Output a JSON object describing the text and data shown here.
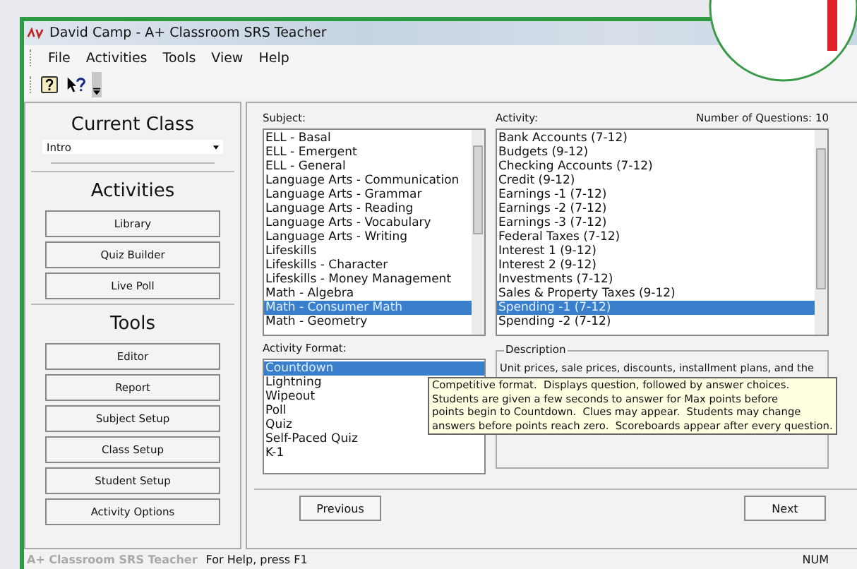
{
  "window": {
    "title": "David Camp - A+ Classroom SRS Teacher"
  },
  "menu": [
    "File",
    "Activities",
    "Tools",
    "View",
    "Help"
  ],
  "sidebar": {
    "current_class_heading": "Current Class",
    "class_dropdown": {
      "value": "Intro"
    },
    "sections": [
      {
        "heading": "Activities",
        "buttons": [
          "Library",
          "Quiz Builder",
          "Live Poll"
        ]
      },
      {
        "heading": "Tools",
        "buttons": [
          "Editor",
          "Report",
          "Subject Setup",
          "Class Setup",
          "Student Setup",
          "Activity Options"
        ]
      }
    ]
  },
  "subject": {
    "label": "Subject:",
    "items": [
      {
        "text": "ELL - Basal",
        "selected": false
      },
      {
        "text": "ELL - Emergent",
        "selected": false
      },
      {
        "text": "ELL - General",
        "selected": false
      },
      {
        "text": "Language Arts - Communication",
        "selected": false
      },
      {
        "text": "Language Arts - Grammar",
        "selected": false
      },
      {
        "text": "Language Arts - Reading",
        "selected": false
      },
      {
        "text": "Language Arts - Vocabulary",
        "selected": false
      },
      {
        "text": "Language Arts - Writing",
        "selected": false
      },
      {
        "text": "Lifeskills",
        "selected": false
      },
      {
        "text": "Lifeskills - Character",
        "selected": false
      },
      {
        "text": "Lifeskills - Money Management",
        "selected": false
      },
      {
        "text": "Math - Algebra",
        "selected": false
      },
      {
        "text": "Math - Consumer Math",
        "selected": true
      },
      {
        "text": "Math - Geometry",
        "selected": false
      }
    ]
  },
  "activity": {
    "label": "Activity:",
    "question_count": "Number of Questions:  10",
    "items": [
      {
        "text": "Bank Accounts (7-12)",
        "selected": false
      },
      {
        "text": "Budgets (9-12)",
        "selected": false
      },
      {
        "text": "Checking Accounts (7-12)",
        "selected": false
      },
      {
        "text": "Credit (9-12)",
        "selected": false
      },
      {
        "text": "Earnings -1 (7-12)",
        "selected": false
      },
      {
        "text": "Earnings -2 (7-12)",
        "selected": false
      },
      {
        "text": "Earnings -3 (7-12)",
        "selected": false
      },
      {
        "text": "Federal Taxes (7-12)",
        "selected": false
      },
      {
        "text": "Interest 1 (9-12)",
        "selected": false
      },
      {
        "text": "Interest 2 (9-12)",
        "selected": false
      },
      {
        "text": "Investments (7-12)",
        "selected": false
      },
      {
        "text": "Sales & Property Taxes (9-12)",
        "selected": false
      },
      {
        "text": "Spending -1 (7-12)",
        "selected": true
      },
      {
        "text": "Spending -2 (7-12)",
        "selected": false
      }
    ]
  },
  "activity_format": {
    "label": "Activity Format:",
    "items": [
      {
        "text": "Countdown",
        "selected": true
      },
      {
        "text": "Lightning",
        "selected": false
      },
      {
        "text": "Wipeout",
        "selected": false
      },
      {
        "text": "Poll",
        "selected": false
      },
      {
        "text": "Quiz",
        "selected": false
      },
      {
        "text": "Self-Paced Quiz",
        "selected": false
      },
      {
        "text": "K-1",
        "selected": false
      }
    ]
  },
  "description": {
    "legend": "Description",
    "text": "Unit prices, sale prices, discounts, installment plans, and the"
  },
  "tooltip": {
    "lines": [
      "Competitive format.  Displays question, followed by answer choices.",
      "Students are given a few seconds to answer for Max points before",
      "points begin to Countdown.  Clues may appear.  Students may change",
      "answers before points reach zero.  Scoreboards appear after every question."
    ]
  },
  "buttons": {
    "previous": "Previous",
    "next": "Next"
  },
  "status_bar": {
    "app": "A+ Classroom SRS Teacher",
    "help": "For Help, press F1",
    "indicator": "NUM"
  }
}
